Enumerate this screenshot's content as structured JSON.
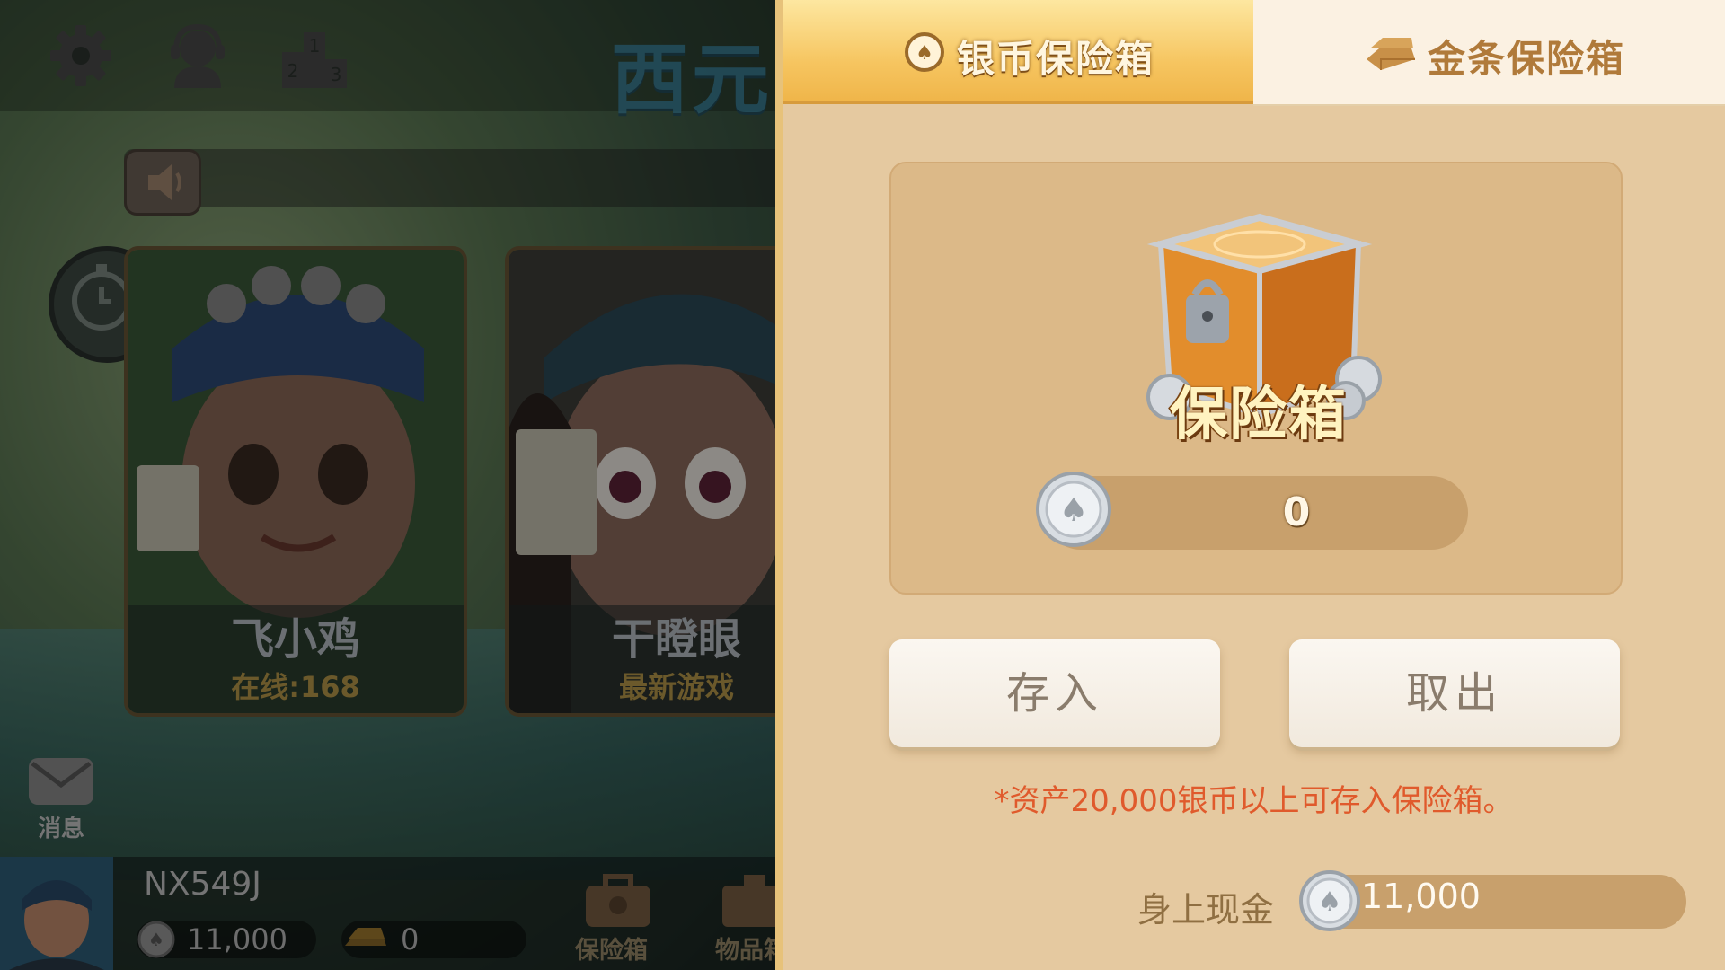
{
  "lobby": {
    "title": "西元",
    "games": [
      {
        "name": "飞小鸡",
        "status": "在线:168"
      },
      {
        "name": "干瞪眼",
        "status": "最新游戏"
      }
    ],
    "messages_label": "消息",
    "player": {
      "name": "NX549J",
      "silver": "11,000",
      "gold": "0"
    },
    "bottom_buttons": [
      {
        "label": "保险箱"
      },
      {
        "label": "物品箱"
      }
    ]
  },
  "safe": {
    "tabs": [
      {
        "label": "银币保险箱",
        "active": true
      },
      {
        "label": "金条保险箱",
        "active": false
      }
    ],
    "chest_label": "保险箱",
    "vault_amount": "0",
    "deposit_label": "存入",
    "withdraw_label": "取出",
    "notice": "*资产20,000银币以上可存入保险箱。",
    "cash_label": "身上现金",
    "cash_amount": "11,000"
  },
  "colors": {
    "tab_active": "#f6c560",
    "panel_bg": "#e5c9a0",
    "notice_red": "#e05a2c",
    "button_bg": "#fbf7f1"
  }
}
